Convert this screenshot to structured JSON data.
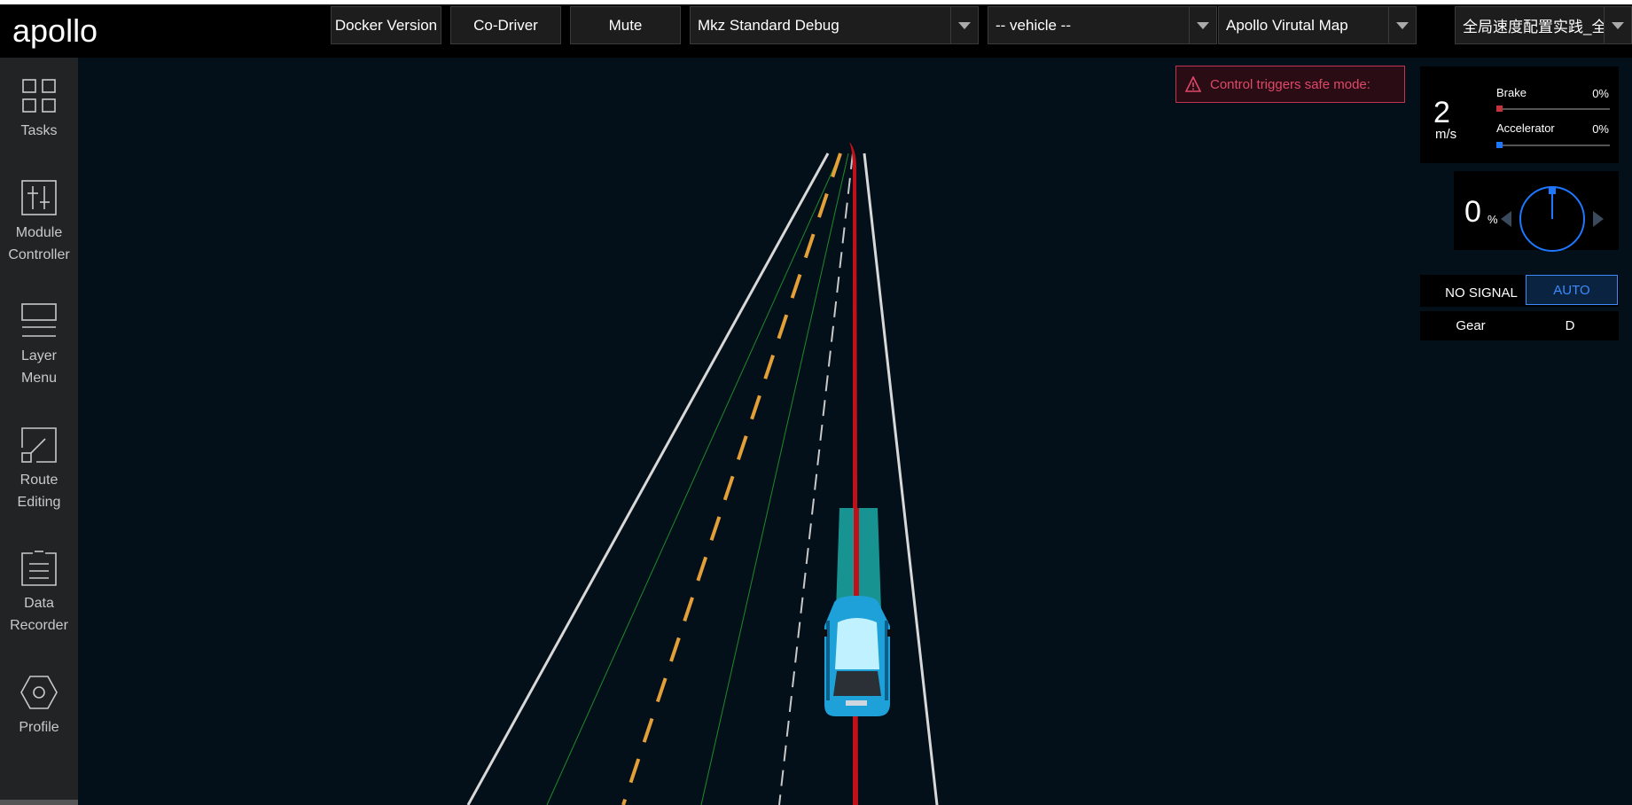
{
  "header": {
    "logo_text": "apollo",
    "docker_button": "Docker Version",
    "codriver_button": "Co-Driver",
    "mute_button": "Mute",
    "mode_select": "Mkz Standard Debug",
    "vehicle_select": "-- vehicle --",
    "map_select": "Apollo Virutal Map",
    "scenario_select": "全局速度配置实践_全局"
  },
  "sidebar": {
    "items": [
      {
        "label": "Tasks",
        "icon": "grid-icon"
      },
      {
        "label": "Module\nController",
        "icon": "sliders-icon"
      },
      {
        "label": "Layer\nMenu",
        "icon": "layers-icon"
      },
      {
        "label": "Route\nEditing",
        "icon": "route-icon"
      },
      {
        "label": "Data\nRecorder",
        "icon": "clipboard-icon"
      },
      {
        "label": "Profile",
        "icon": "hexagon-icon"
      }
    ]
  },
  "alert": {
    "message": "Control triggers safe mode:",
    "color": "#e0486a"
  },
  "dashboard": {
    "speed_value": "2",
    "speed_unit": "m/s",
    "brake_label": "Brake",
    "brake_value": "0%",
    "accelerator_label": "Accelerator",
    "accelerator_value": "0%",
    "steering_value": "0",
    "steering_unit": "%",
    "signal_label": "NO SIGNAL",
    "drive_mode": "AUTO",
    "gear_label": "Gear",
    "gear_value": "D"
  },
  "colors": {
    "brake": "#c8323c",
    "accelerator": "#1e78ff",
    "lane_yellow": "#e3a038",
    "lane_white": "#d8d8d8",
    "planning_red": "#c0101a",
    "vehicle_teal": "#1aa3a0",
    "auto_accent": "#3d8bff"
  }
}
